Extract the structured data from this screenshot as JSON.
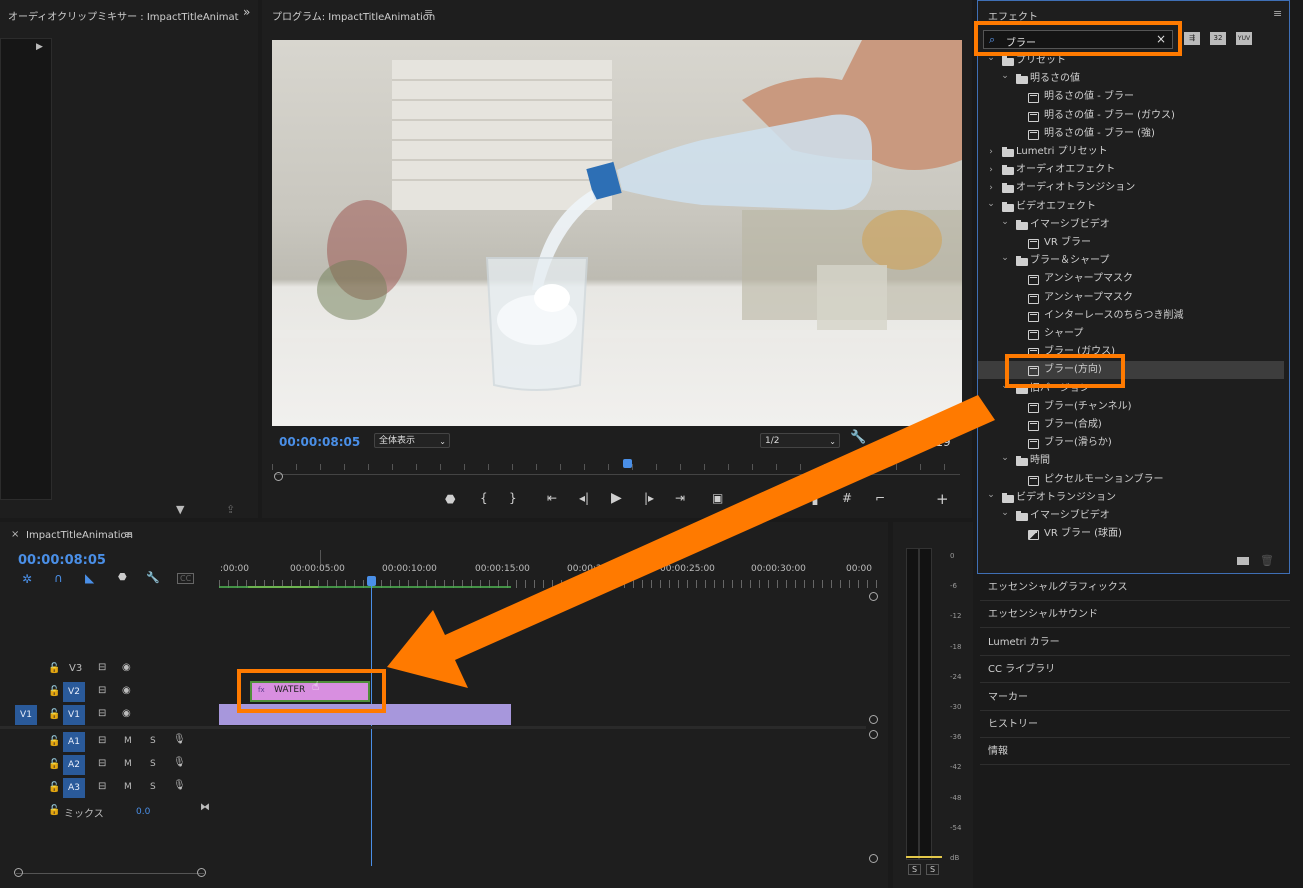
{
  "audio_mixer": {
    "title": "オーディオクリップミキサー : ImpactTitleAnimat",
    "expand": "»"
  },
  "program": {
    "title": "プログラム: ImpactTitleAnimation",
    "timecode": "00:00:08:05",
    "zoom": "全体表示",
    "resolution": "1/2",
    "duration_suffix": "15:19"
  },
  "effects": {
    "title": "エフェクト",
    "search_value": "ブラー",
    "tree": [
      {
        "level": 0,
        "kind": "preset-folder",
        "open": true,
        "label": "プリセット"
      },
      {
        "level": 1,
        "kind": "preset-folder",
        "open": true,
        "label": "明るさの値"
      },
      {
        "level": 2,
        "kind": "preset",
        "label": "明るさの値 - ブラー"
      },
      {
        "level": 2,
        "kind": "preset",
        "label": "明るさの値 - ブラー (ガウス)"
      },
      {
        "level": 2,
        "kind": "preset",
        "label": "明るさの値 - ブラー (強)"
      },
      {
        "level": 0,
        "kind": "folder",
        "open": false,
        "label": "Lumetri プリセット"
      },
      {
        "level": 0,
        "kind": "folder",
        "open": false,
        "label": "オーディオエフェクト"
      },
      {
        "level": 0,
        "kind": "folder",
        "open": false,
        "label": "オーディオトランジション"
      },
      {
        "level": 0,
        "kind": "folder",
        "open": true,
        "label": "ビデオエフェクト"
      },
      {
        "level": 1,
        "kind": "folder",
        "open": true,
        "label": "イマーシブビデオ"
      },
      {
        "level": 2,
        "kind": "effect",
        "label": "VR ブラー"
      },
      {
        "level": 1,
        "kind": "folder",
        "open": true,
        "label": "ブラー＆シャープ"
      },
      {
        "level": 2,
        "kind": "effect",
        "label": "アンシャープマスク"
      },
      {
        "level": 2,
        "kind": "effect",
        "label": "アンシャープマスク"
      },
      {
        "level": 2,
        "kind": "effect",
        "label": "インターレースのちらつき削減"
      },
      {
        "level": 2,
        "kind": "effect",
        "label": "シャープ"
      },
      {
        "level": 2,
        "kind": "effect",
        "label": "ブラー (ガウス)"
      },
      {
        "level": 2,
        "kind": "effect",
        "label": "ブラー(方向)",
        "selected": true
      },
      {
        "level": 1,
        "kind": "folder",
        "open": true,
        "label": "旧バージョン"
      },
      {
        "level": 2,
        "kind": "effect",
        "label": "ブラー(チャンネル)"
      },
      {
        "level": 2,
        "kind": "effect",
        "label": "ブラー(合成)"
      },
      {
        "level": 2,
        "kind": "effect",
        "label": "ブラー(滑らか)"
      },
      {
        "level": 1,
        "kind": "folder",
        "open": true,
        "label": "時間"
      },
      {
        "level": 2,
        "kind": "effect",
        "label": "ピクセルモーションブラー"
      },
      {
        "level": 0,
        "kind": "folder",
        "open": true,
        "label": "ビデオトランジション"
      },
      {
        "level": 1,
        "kind": "folder",
        "open": true,
        "label": "イマーシブビデオ"
      },
      {
        "level": 2,
        "kind": "transition",
        "label": "VR ブラー (球面)"
      }
    ]
  },
  "side_panels": [
    "エッセンシャルグラフィックス",
    "エッセンシャルサウンド",
    "Lumetri カラー",
    "CC ライブラリ",
    "マーカー",
    "ヒストリー",
    "情報"
  ],
  "timeline": {
    "sequence_name": "ImpactTitleAnimation",
    "timecode": "00:00:08:05",
    "ruler": [
      ":00:00",
      "00:00:05:00",
      "00:00:10:00",
      "00:00:15:00",
      "00:00:20:00",
      "00:00:25:00",
      "00:00:30:00",
      "00:00"
    ],
    "tracks": {
      "v3": "V3",
      "v2": "V2",
      "v1": "V1",
      "src_v1": "V1",
      "a1": "A1",
      "a2": "A2",
      "a3": "A3",
      "mix": "ミックス",
      "mix_value": "0.0",
      "m": "M",
      "s": "S"
    },
    "title_clip": "WATER"
  },
  "meter": {
    "labels": [
      "0",
      "-6",
      "-12",
      "-18",
      "-24",
      "-30",
      "-36",
      "-42",
      "-48",
      "-54",
      "dB"
    ],
    "solo": "S"
  }
}
